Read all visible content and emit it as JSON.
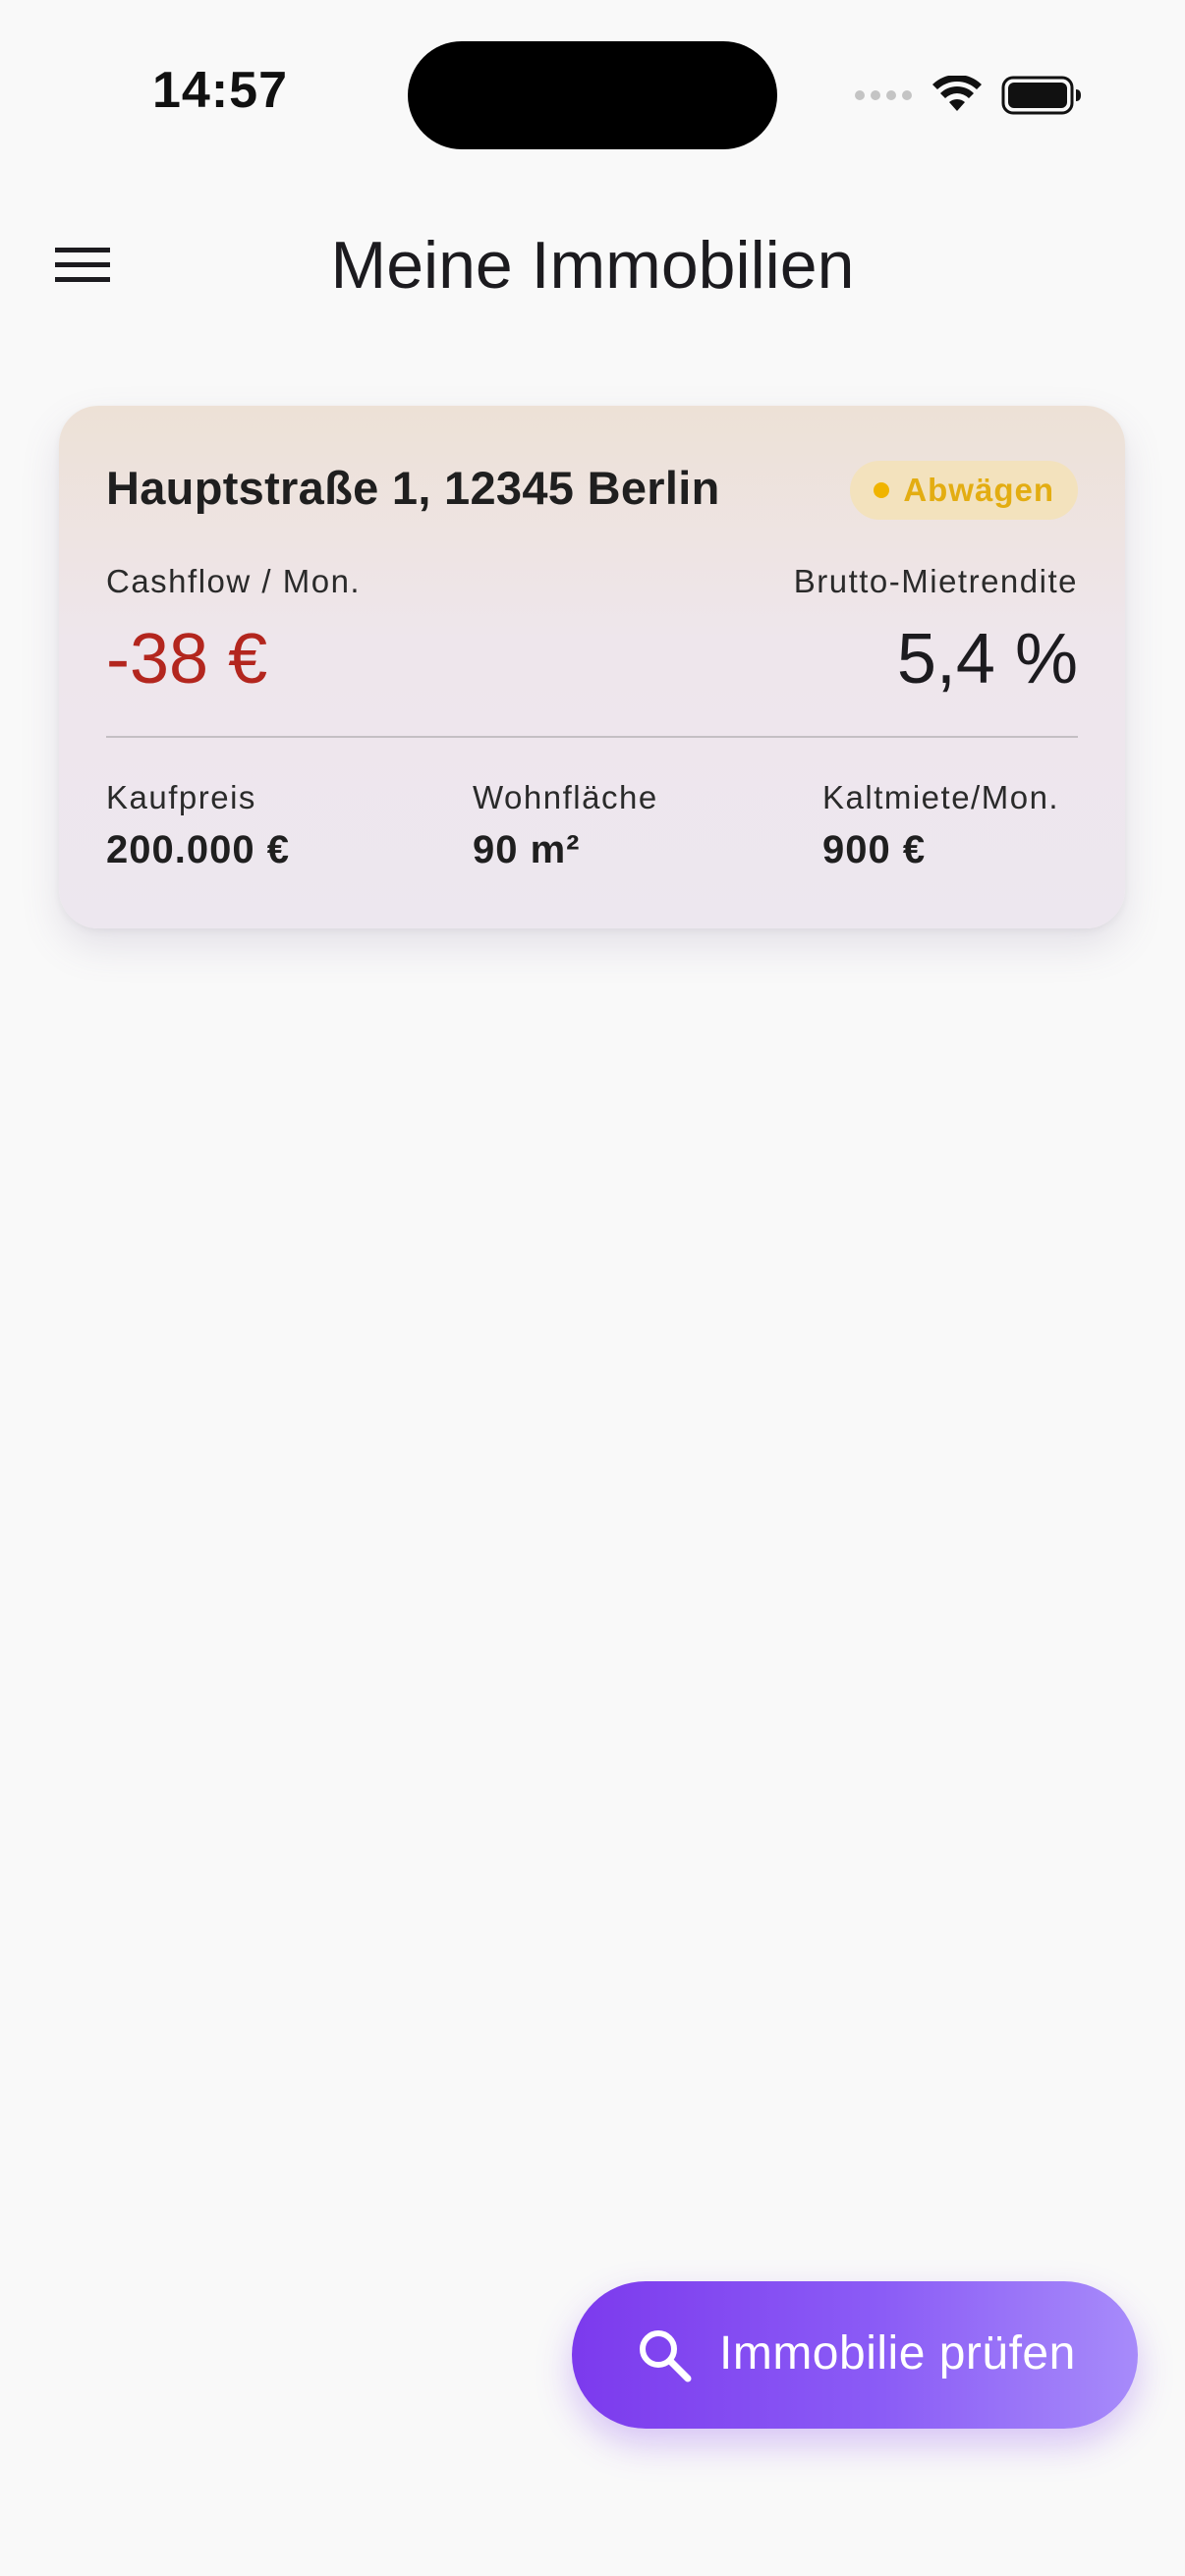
{
  "status_bar": {
    "time": "14:57",
    "icons": [
      "signal-dots-icon",
      "wifi-icon",
      "battery-icon"
    ]
  },
  "app_bar": {
    "title": "Meine Immobilien",
    "menu_icon": "hamburger-menu-icon"
  },
  "property_card": {
    "address": "Hauptstraße 1, 12345 Berlin",
    "status_badge": {
      "label": "Abwägen",
      "color": "#e3ad12",
      "background": "#f3e2bd"
    },
    "cashflow": {
      "label": "Cashflow / Mon.",
      "value": "-38 €",
      "color": "#b3261e"
    },
    "gross_yield": {
      "label": "Brutto-Mietrendite",
      "value": "5,4 %"
    },
    "details": [
      {
        "label": "Kaufpreis",
        "value": "200.000 €"
      },
      {
        "label": "Wohnfläche",
        "value": "90 m²"
      },
      {
        "label": "Kaltmiete/Mon.",
        "value": "900 €"
      }
    ]
  },
  "fab": {
    "label": "Immobilie prüfen",
    "icon": "search-icon",
    "accent": "#7c3aed"
  }
}
